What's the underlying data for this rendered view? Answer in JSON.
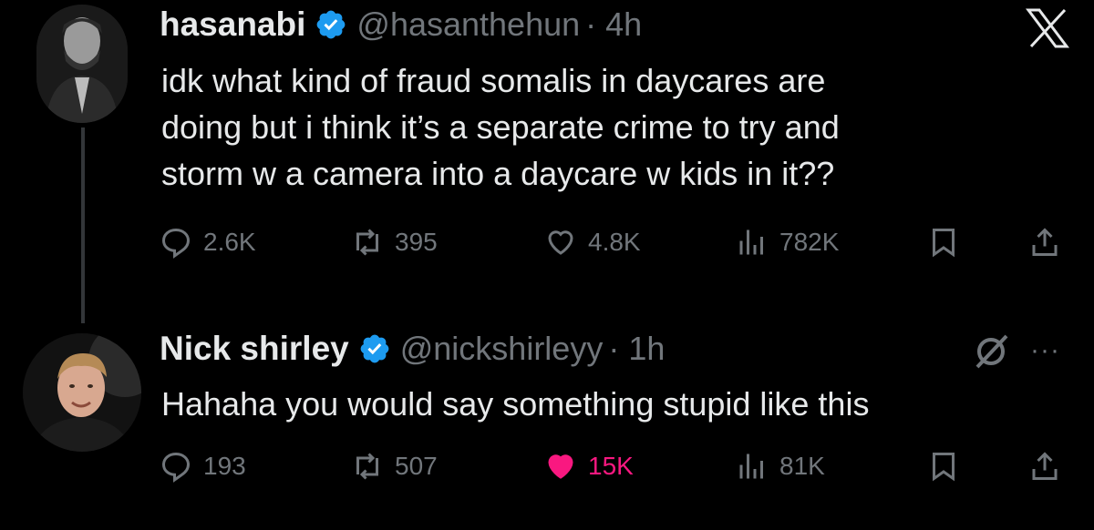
{
  "colors": {
    "background": "#000000",
    "text": "#e7e9ea",
    "muted": "#71767b",
    "verified": "#1d9bf0",
    "like": "#f91880"
  },
  "icons": {
    "x_logo": "x-logo-icon",
    "verified": "verified-badge-icon",
    "reply": "reply-icon",
    "repost": "repost-icon",
    "like": "heart-icon",
    "views": "views-icon",
    "bookmark": "bookmark-icon",
    "share": "share-icon",
    "grok": "grok-icon",
    "more": "more-icon"
  },
  "tweet1": {
    "name": "hasanabi",
    "handle": "@hasanthehun",
    "time": "· 4h",
    "lines": [
      "idk what kind of fraud somalis in daycares are",
      "doing but i think it’s a separate crime to try and",
      "storm w a camera into a daycare w kids in it??"
    ],
    "replies": "2.6K",
    "reposts": "395",
    "likes": "4.8K",
    "views": "782K",
    "liked": false
  },
  "tweet2": {
    "name": "Nick shirley",
    "handle": "@nickshirleyy",
    "time": "· 1h",
    "text": "Hahaha you would say something stupid like this",
    "more": "···",
    "replies": "193",
    "reposts": "507",
    "likes": "15K",
    "views": "81K",
    "liked": true
  }
}
